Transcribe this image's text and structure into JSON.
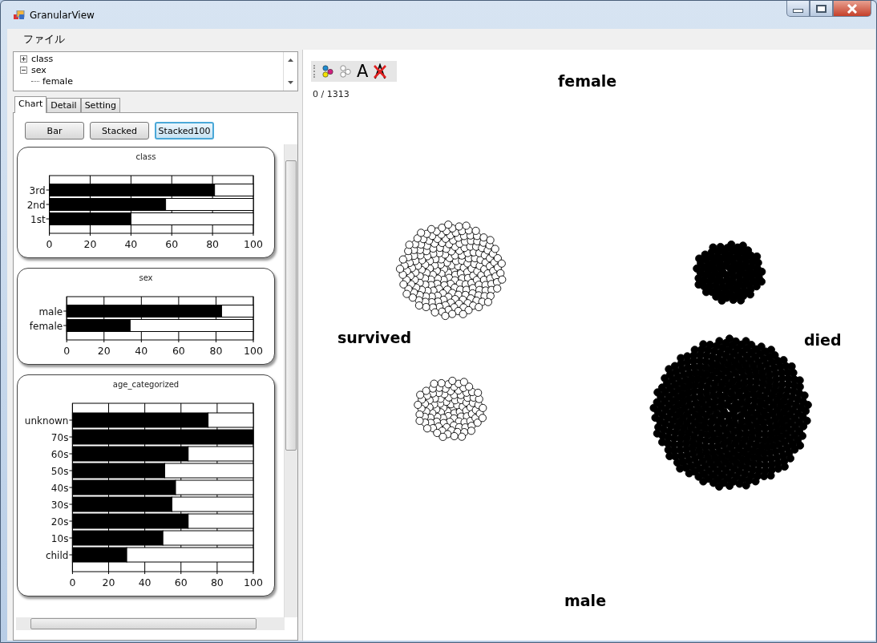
{
  "window": {
    "title": "GranularView"
  },
  "menu": [
    "ファイル"
  ],
  "tree": [
    {
      "label": "class",
      "expanded": false
    },
    {
      "label": "sex",
      "expanded": true,
      "children": [
        {
          "label": "female"
        }
      ]
    }
  ],
  "tabs": [
    {
      "label": "Chart",
      "selected": true
    },
    {
      "label": "Detail",
      "selected": false
    },
    {
      "label": "Setting",
      "selected": false
    }
  ],
  "chart_modes": [
    {
      "label": "Bar",
      "selected": false
    },
    {
      "label": "Stacked",
      "selected": false
    },
    {
      "label": "Stacked100",
      "selected": true
    }
  ],
  "charts": [
    {
      "chart_data": {
        "type": "bar",
        "orientation": "horizontal",
        "stacked": true,
        "grid": true,
        "title": "class",
        "categories": [
          "3rd",
          "2nd",
          "1st"
        ],
        "series": [
          {
            "color": "#000000",
            "values": [
              81,
              57,
              40
            ]
          },
          {
            "color": "#ffffff",
            "values": [
              19,
              43,
              60
            ]
          }
        ],
        "xlim": [
          0,
          100
        ],
        "xticks": [
          0,
          20,
          40,
          60,
          80,
          100
        ]
      }
    },
    {
      "chart_data": {
        "type": "bar",
        "orientation": "horizontal",
        "stacked": true,
        "grid": true,
        "title": "sex",
        "categories": [
          "male",
          "female"
        ],
        "series": [
          {
            "color": "#000000",
            "values": [
              83,
              34
            ]
          },
          {
            "color": "#ffffff",
            "values": [
              17,
              66
            ]
          }
        ],
        "xlim": [
          0,
          100
        ],
        "xticks": [
          0,
          20,
          40,
          60,
          80,
          100
        ]
      }
    },
    {
      "chart_data": {
        "type": "bar",
        "orientation": "horizontal",
        "stacked": true,
        "grid": true,
        "title": "age_categorized",
        "categories": [
          "unknown",
          "70s",
          "60s",
          "50s",
          "40s",
          "30s",
          "20s",
          "10s",
          "child"
        ],
        "series": [
          {
            "color": "#000000",
            "values": [
              75,
              100,
              64,
              51,
              57,
              55,
              64,
              50,
              30
            ]
          },
          {
            "color": "#ffffff",
            "values": [
              25,
              0,
              36,
              49,
              43,
              45,
              36,
              50,
              70
            ]
          }
        ],
        "xlim": [
          0,
          100
        ],
        "xticks": [
          0,
          20,
          40,
          60,
          80,
          100
        ]
      }
    }
  ],
  "toolbar": {
    "text_tool": "A"
  },
  "selection_count": "0 / 1313",
  "axis_labels": {
    "top": "female",
    "bottom": "male",
    "left": "survived",
    "right": "died"
  }
}
